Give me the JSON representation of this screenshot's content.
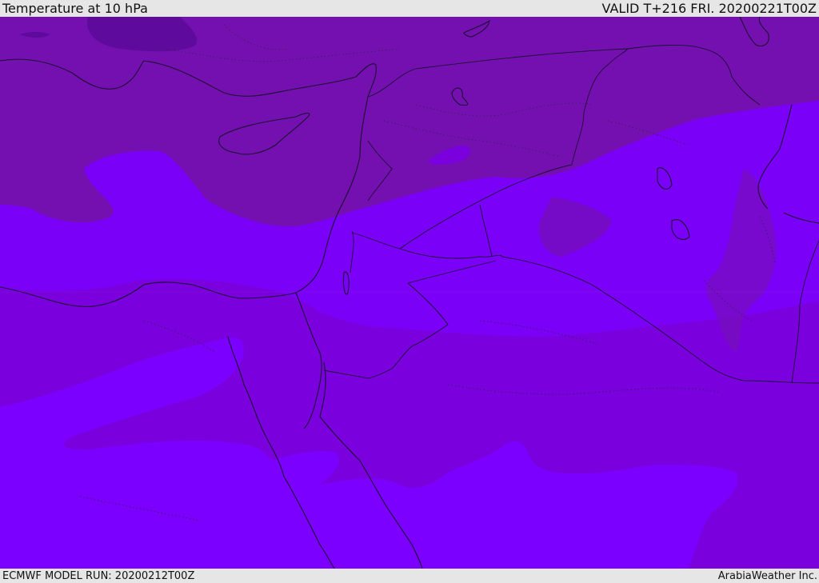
{
  "header": {
    "title": "Temperature at 10 hPa",
    "valid": "VALID T+216 FRI. 20200221T00Z"
  },
  "footer": {
    "model_run": "ECMWF MODEL RUN: 20200212T00Z",
    "credit": "ArabiaWeather Inc."
  },
  "colors": {
    "band_darkest": "#5e0a9c",
    "band_dark": "#7410b0",
    "band_mid": "#7a00de",
    "band_light": "#7b00f8",
    "band_lightest": "#7c00ff",
    "coastline": "#1a1030",
    "border_dotted": "#3a2060"
  }
}
